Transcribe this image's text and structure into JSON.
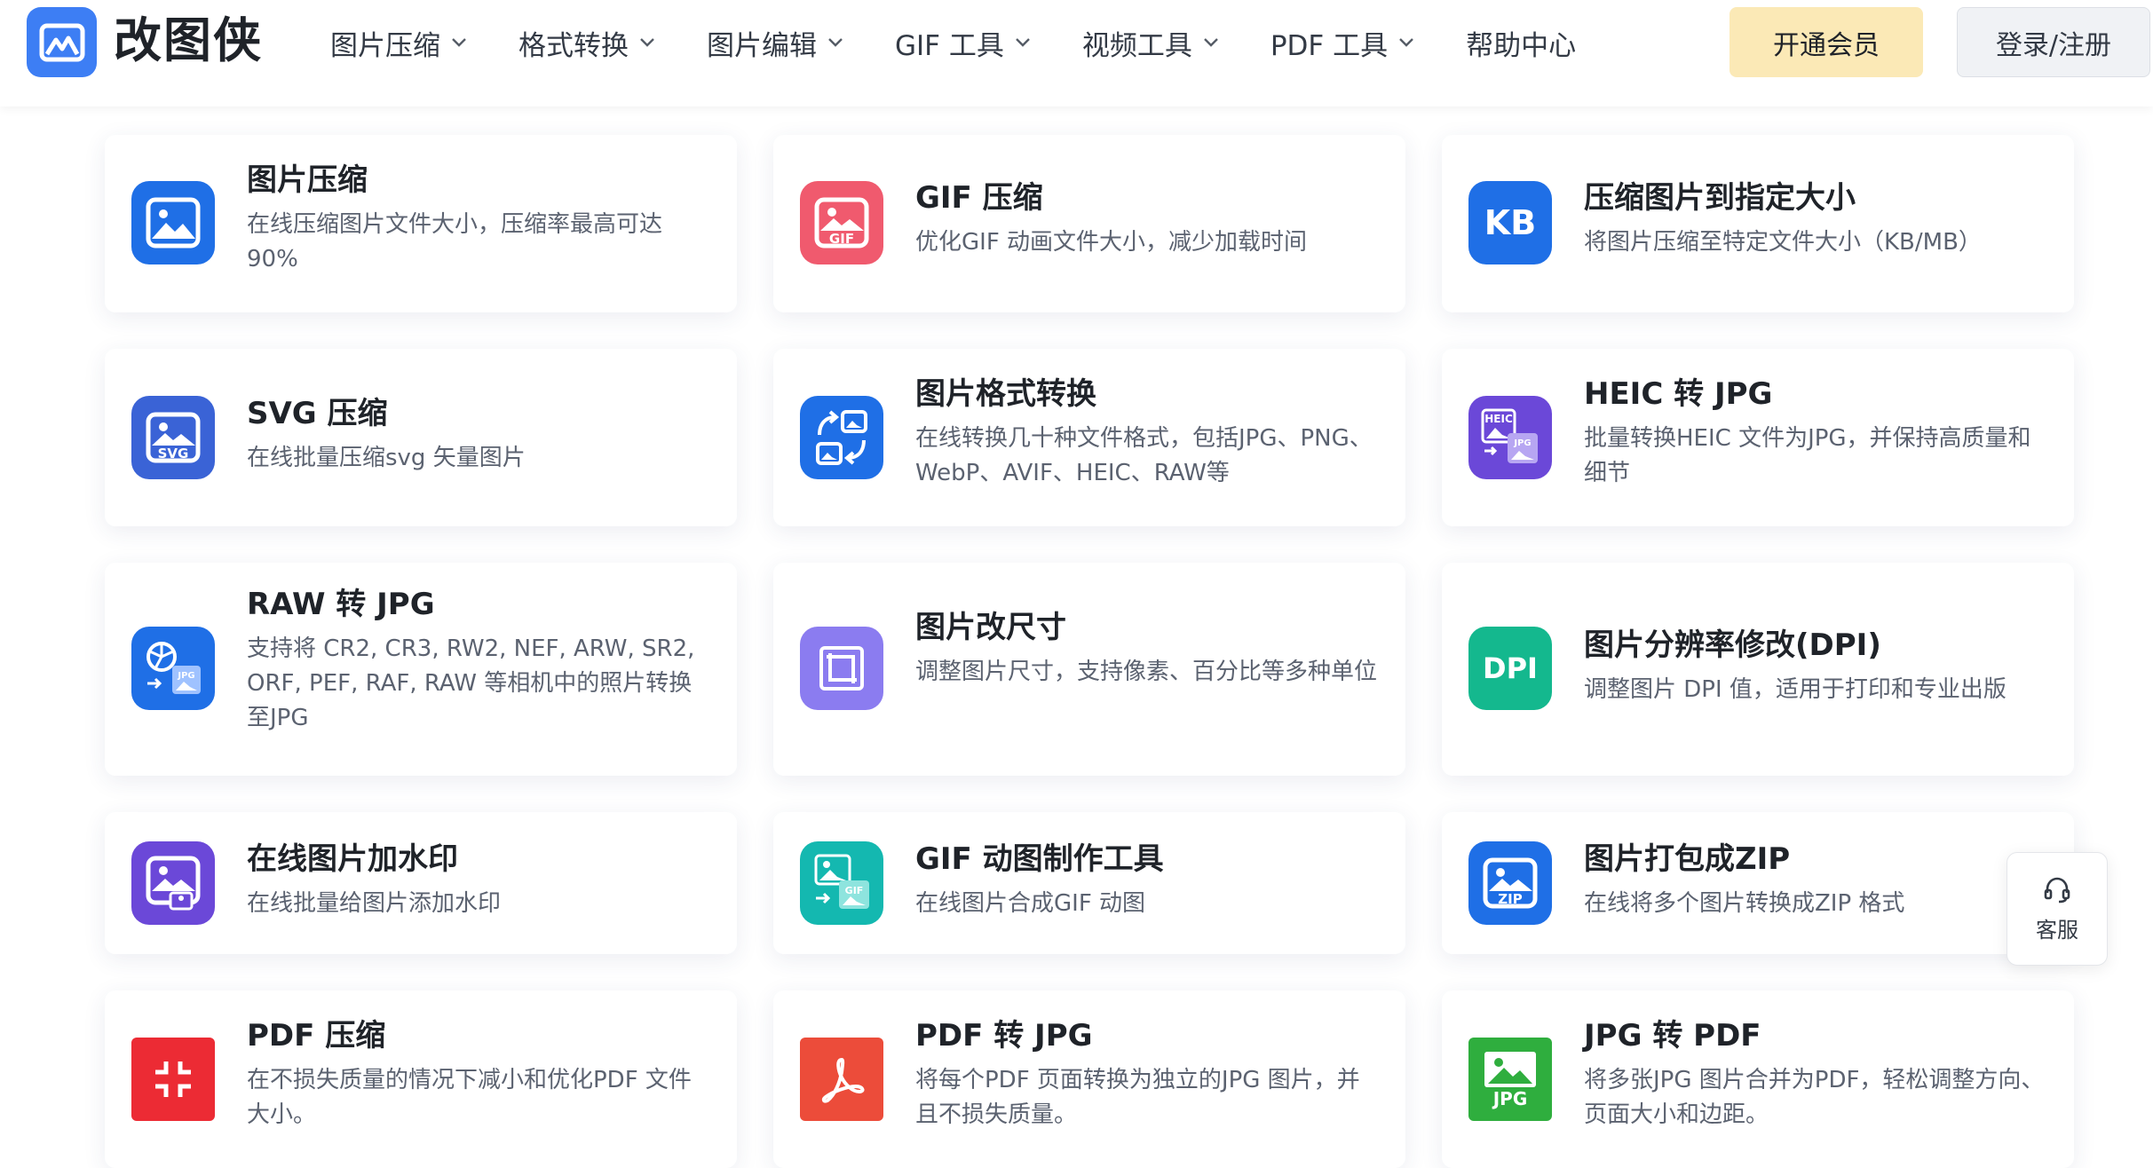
{
  "header": {
    "brand": "改图侠",
    "nav": [
      {
        "label": "图片压缩"
      },
      {
        "label": "格式转换"
      },
      {
        "label": "图片编辑"
      },
      {
        "label": "GIF 工具"
      },
      {
        "label": "视频工具"
      },
      {
        "label": "PDF 工具"
      },
      {
        "label": "帮助中心"
      }
    ],
    "vip_label": "开通会员",
    "login_label": "登录/注册"
  },
  "cards": [
    {
      "title": "图片压缩",
      "desc": "在线压缩图片文件大小，压缩率最高可达90%",
      "icon": "image-icon",
      "color": "#1f6fe6"
    },
    {
      "title": "GIF 压缩",
      "desc": "优化GIF 动画文件大小，减少加载时间",
      "icon": "gif-icon",
      "color": "#f05a6e",
      "badge": "GIF"
    },
    {
      "title": "压缩图片到指定大小",
      "desc": "将图片压缩至特定文件大小（KB/MB）",
      "icon": "kb-icon",
      "color": "#1f6fe6",
      "badge": "KB"
    },
    {
      "title": "SVG 压缩",
      "desc": "在线批量压缩svg 矢量图片",
      "icon": "svg-icon",
      "color": "#3a63d6",
      "badge": "SVG"
    },
    {
      "title": "图片格式转换",
      "desc": "在线转换几十种文件格式，包括JPG、PNG、WebP、AVIF、HEIC、RAW等",
      "icon": "convert-icon",
      "color": "#1f6fe6"
    },
    {
      "title": "HEIC 转 JPG",
      "desc": "批量转换HEIC 文件为JPG，并保持高质量和细节",
      "icon": "heic-icon",
      "color": "#6b48d8",
      "badge": "HEIC",
      "badge2": "JPG"
    },
    {
      "title": "RAW 转 JPG",
      "desc": "支持将 CR2, CR3, RW2, NEF, ARW, SR2, ORF, PEF, RAF, RAW 等相机中的照片转换至JPG",
      "icon": "raw-icon",
      "color": "#1f6fe6",
      "badge": "JPG"
    },
    {
      "title": "图片改尺寸",
      "desc": "调整图片尺寸，支持像素、百分比等多种单位",
      "icon": "crop-icon",
      "color": "#8b7cf0"
    },
    {
      "title": "图片分辨率修改(DPI)",
      "desc": "调整图片 DPI 值，适用于打印和专业出版",
      "icon": "dpi-icon",
      "color": "#14b88e",
      "badge": "DPI"
    },
    {
      "title": "在线图片加水印",
      "desc": "在线批量给图片添加水印",
      "icon": "watermark-icon",
      "color": "#6b48d8"
    },
    {
      "title": "GIF 动图制作工具",
      "desc": "在线图片合成GIF 动图",
      "icon": "gif-maker-icon",
      "color": "#14b8b0",
      "badge": "GIF"
    },
    {
      "title": "图片打包成ZIP",
      "desc": "在线将多个图片转换成ZIP 格式",
      "icon": "zip-icon",
      "color": "#1f6fe6",
      "badge": "ZIP"
    },
    {
      "title": "PDF 压缩",
      "desc": "在不损失质量的情况下减小和优化PDF 文件大小。",
      "icon": "pdf-compress-icon",
      "color": "#ec2b34"
    },
    {
      "title": "PDF 转 JPG",
      "desc": "将每个PDF 页面转换为独立的JPG 图片，并且不损失质量。",
      "icon": "pdf-icon",
      "color": "#ec4c3a"
    },
    {
      "title": "JPG 转 PDF",
      "desc": "将多张JPG 图片合并为PDF，轻松调整方向、页面大小和边距。",
      "icon": "jpg-icon",
      "color": "#2fae3e",
      "badge": "JPG"
    }
  ],
  "support_label": "客服"
}
